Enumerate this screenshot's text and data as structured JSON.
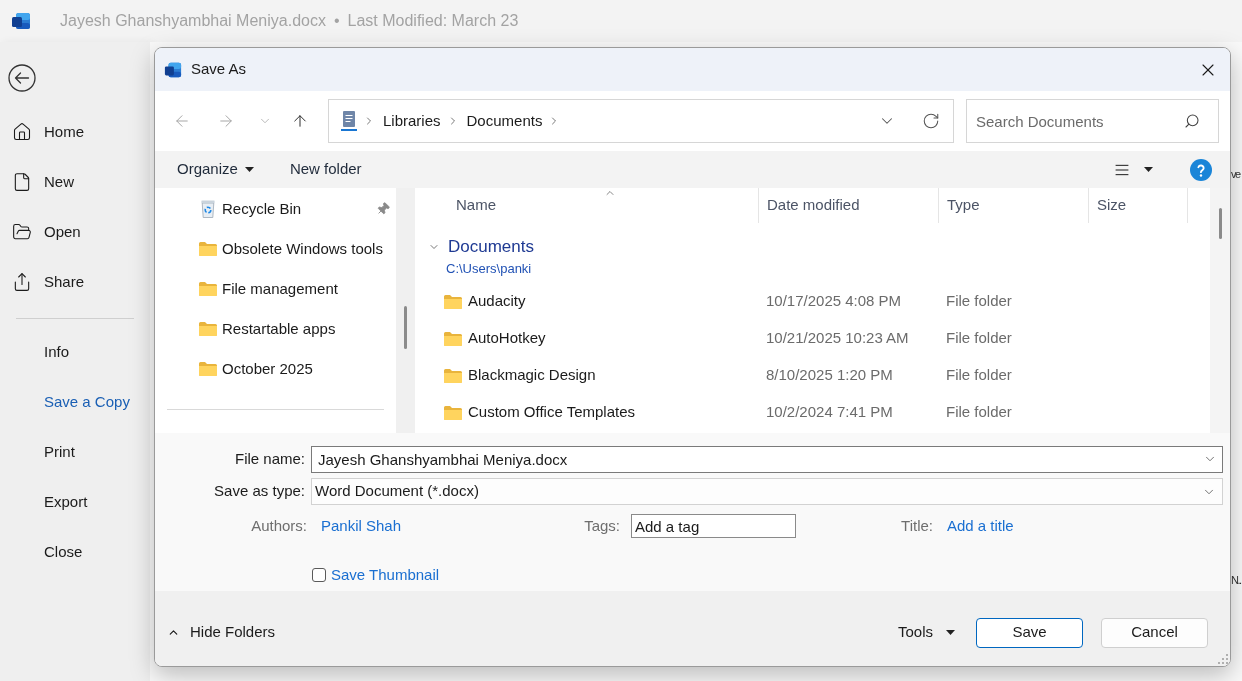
{
  "app": {
    "file_name": "Jayesh Ghanshyambhai Meniya.docx",
    "separator": "•",
    "last_modified": "Last Modified: March 23"
  },
  "backstage": {
    "primary_items": [
      {
        "kind": "home",
        "label": "Home",
        "selected": false
      },
      {
        "kind": "new",
        "label": "New",
        "selected": false
      },
      {
        "kind": "open",
        "label": "Open",
        "selected": false
      },
      {
        "kind": "share",
        "label": "Share",
        "selected": false
      }
    ],
    "secondary_items": [
      {
        "label": "Info",
        "selected": false
      },
      {
        "label": "Save a Copy",
        "selected": true
      },
      {
        "label": "Print",
        "selected": false
      },
      {
        "label": "Export",
        "selected": false
      },
      {
        "label": "Close",
        "selected": false
      }
    ]
  },
  "background_text": [
    "ve",
    "N.."
  ],
  "dialog": {
    "title": "Save As",
    "nav_buttons": [
      {
        "kind": "back",
        "disabled": true
      },
      {
        "kind": "forward",
        "disabled": true
      },
      {
        "kind": "recent",
        "disabled": true
      },
      {
        "kind": "up",
        "disabled": false
      }
    ],
    "address": {
      "crumbs": [
        "Libraries",
        "Documents"
      ]
    },
    "search": {
      "placeholder": "Search Documents"
    },
    "toolbar": {
      "organize": "Organize",
      "new_folder": "New folder"
    },
    "nav_pane": {
      "items": [
        {
          "kind": "recycle_bin",
          "label": "Recycle Bin",
          "pinned": true
        },
        {
          "kind": "folder",
          "label": "Obsolete Windows tools",
          "pinned": false
        },
        {
          "kind": "folder",
          "label": "File management",
          "pinned": false
        },
        {
          "kind": "folder",
          "label": "Restartable apps",
          "pinned": false
        },
        {
          "kind": "folder",
          "label": "October 2025",
          "pinned": false
        }
      ]
    },
    "file_list": {
      "columns": [
        {
          "label": "Name",
          "sorted": true
        },
        {
          "label": "Date modified",
          "sorted": false
        },
        {
          "label": "Type",
          "sorted": false
        },
        {
          "label": "Size",
          "sorted": false
        }
      ],
      "group": {
        "title": "Documents",
        "path": "C:\\Users\\panki",
        "expanded": true
      },
      "rows": [
        {
          "name": "Audacity",
          "date_modified": "10/17/2025 4:08 PM",
          "type": "File folder"
        },
        {
          "name": "AutoHotkey",
          "date_modified": "10/21/2025 10:23 AM",
          "type": "File folder"
        },
        {
          "name": "Blackmagic Design",
          "date_modified": "8/10/2025 1:20 PM",
          "type": "File folder"
        },
        {
          "name": "Custom Office Templates",
          "date_modified": "10/2/2024 7:41 PM",
          "type": "File folder"
        }
      ]
    },
    "file_name": {
      "label": "File name:",
      "value": "Jayesh Ghanshyambhai Meniya.docx"
    },
    "save_as_type": {
      "label": "Save as type:",
      "value": "Word Document (*.docx)"
    },
    "authors": {
      "label": "Authors:",
      "value": "Pankil Shah"
    },
    "tags": {
      "label": "Tags:",
      "placeholder": "Add a tag"
    },
    "title_field": {
      "label": "Title:",
      "value": "Add a title"
    },
    "save_thumbnail": {
      "label": "Save Thumbnail",
      "checked": false
    },
    "hide_folders": "Hide Folders",
    "tools": "Tools",
    "buttons": [
      {
        "kind": "primary",
        "label": "Save"
      },
      {
        "kind": "secondary",
        "label": "Cancel"
      }
    ]
  }
}
